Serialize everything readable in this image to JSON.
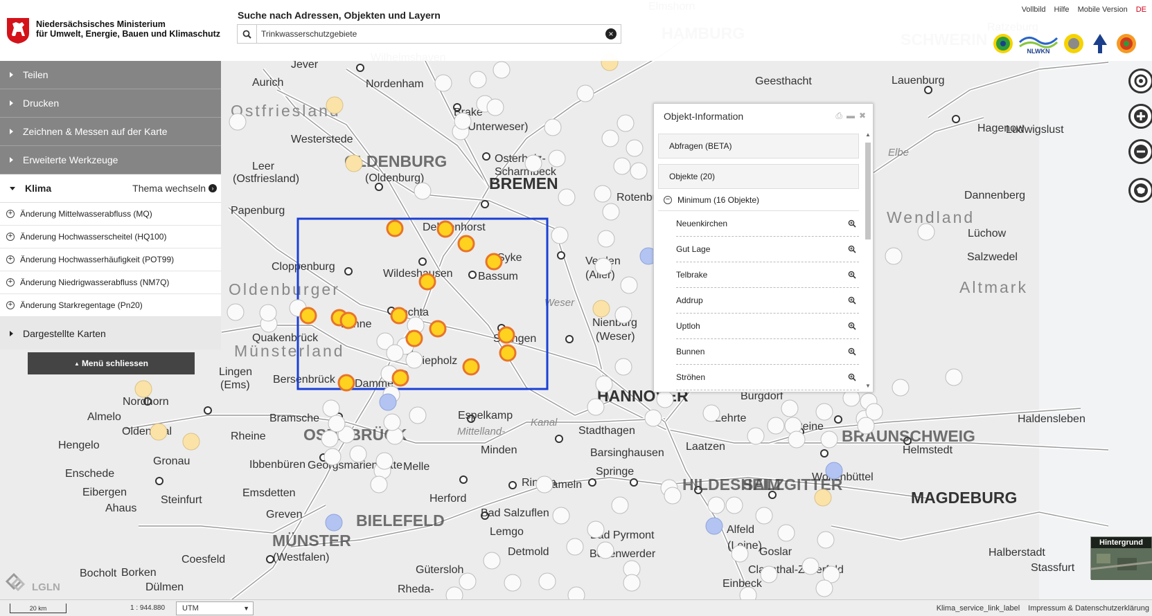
{
  "header": {
    "ministry_line1": "Niedersächsisches Ministerium",
    "ministry_line2": "für Umwelt, Energie, Bauen und Klimaschutz",
    "search_title": "Suche nach Adressen, Objekten und Layern",
    "search_value": "Trinkwasserschutzgebiete",
    "links": [
      "Vollbild",
      "Hilfe",
      "Mobile Version"
    ],
    "language": "DE",
    "partner_logo_text": "NLWKN"
  },
  "menu": {
    "items": [
      "Teilen",
      "Drucken",
      "Zeichnen & Messen auf der Karte",
      "Erweiterte Werkzeuge"
    ],
    "theme_title": "Klima",
    "theme_switch": "Thema wechseln",
    "layers": [
      "Änderung Mittelwasserabfluss (MQ)",
      "Änderung Hochwasserscheitel (HQ100)",
      "Änderung Hochwasserhäufigkeit (POT99)",
      "Änderung Niedrigwasserabfluss (NM7Q)",
      "Änderung Starkregentage (Pn20)"
    ],
    "maps_item": "Dargestellte Karten",
    "close_label": "Menü schliessen"
  },
  "info_panel": {
    "title": "Objekt-Information",
    "query_tab": "Abfragen (BETA)",
    "objects_header": "Objekte (20)",
    "group_label": "Minimum (16 Objekte)",
    "objects": [
      "Neuenkirchen",
      "Gut Lage",
      "Telbrake",
      "Addrup",
      "Uptloh",
      "Bunnen",
      "Ströhen"
    ]
  },
  "map": {
    "labels": [
      {
        "text": "HAMBURG",
        "cls": "big"
      },
      {
        "text": "SCHWERIN",
        "cls": "big"
      },
      {
        "text": "BREMEN",
        "cls": "city"
      },
      {
        "text": "HANNOVER",
        "cls": "city"
      },
      {
        "text": "BIELEFELD",
        "cls": "big"
      },
      {
        "text": "MAGDEBURG",
        "cls": "city"
      },
      {
        "text": "Ostfriesland",
        "cls": "region"
      },
      {
        "text": "Oldenburger",
        "cls": "region"
      },
      {
        "text": "Münsterland",
        "cls": "region"
      },
      {
        "text": "Wendland",
        "cls": "region"
      },
      {
        "text": "Altmark",
        "cls": "region"
      },
      {
        "text": "OLDENBURG",
        "cls": "big"
      },
      {
        "text": "(Oldenburg)",
        "cls": "town"
      },
      {
        "text": "OSNABRÜCK",
        "cls": "big"
      },
      {
        "text": "MÜNSTER",
        "cls": "big"
      },
      {
        "text": "(Westfalen)",
        "cls": "town"
      },
      {
        "text": "BRAUNSCHWEIG",
        "cls": "big"
      },
      {
        "text": "HILDESHEIM",
        "cls": "big"
      },
      {
        "text": "SALZGITTER",
        "cls": "big"
      },
      {
        "text": "Jever",
        "cls": "town"
      },
      {
        "text": "Wilhelmshaven",
        "cls": "town"
      },
      {
        "text": "Nordenham",
        "cls": "town"
      },
      {
        "text": "Aurich",
        "cls": "town"
      },
      {
        "text": "Westerstede",
        "cls": "town"
      },
      {
        "text": "Leer",
        "cls": "town"
      },
      {
        "text": "(Ostfriesland)",
        "cls": "town"
      },
      {
        "text": "Papenburg",
        "cls": "town"
      },
      {
        "text": "Cloppenburg",
        "cls": "town"
      },
      {
        "text": "Wildeshausen",
        "cls": "town"
      },
      {
        "text": "Delmenhorst",
        "cls": "town"
      },
      {
        "text": "Syke",
        "cls": "town"
      },
      {
        "text": "Bassum",
        "cls": "town"
      },
      {
        "text": "Vechta",
        "cls": "town"
      },
      {
        "text": "Lohne",
        "cls": "town"
      },
      {
        "text": "Diepholz",
        "cls": "town"
      },
      {
        "text": "Sulingen",
        "cls": "town"
      },
      {
        "text": "Quakenbrück",
        "cls": "town"
      },
      {
        "text": "Bersenbrück",
        "cls": "town"
      },
      {
        "text": "Damme",
        "cls": "town"
      },
      {
        "text": "Lingen",
        "cls": "town"
      },
      {
        "text": "(Ems)",
        "cls": "town"
      },
      {
        "text": "Nordhorn",
        "cls": "town"
      },
      {
        "text": "Almelo",
        "cls": "town"
      },
      {
        "text": "Oldenzaal",
        "cls": "town"
      },
      {
        "text": "Hengelo",
        "cls": "town"
      },
      {
        "text": "Gronau",
        "cls": "town"
      },
      {
        "text": "Enschede",
        "cls": "town"
      },
      {
        "text": "Eibergen",
        "cls": "town"
      },
      {
        "text": "Ahaus",
        "cls": "town"
      },
      {
        "text": "Steinfurt",
        "cls": "town"
      },
      {
        "text": "Rheine",
        "cls": "town"
      },
      {
        "text": "Ibbenbüren",
        "cls": "town"
      },
      {
        "text": "Emsdetten",
        "cls": "town"
      },
      {
        "text": "Greven",
        "cls": "town"
      },
      {
        "text": "Coesfeld",
        "cls": "town"
      },
      {
        "text": "Bocholt",
        "cls": "town"
      },
      {
        "text": "Borken",
        "cls": "town"
      },
      {
        "text": "Dülmen",
        "cls": "town"
      },
      {
        "text": "Bramsche",
        "cls": "town"
      },
      {
        "text": "Georgsmarienhütte",
        "cls": "town"
      },
      {
        "text": "Melle",
        "cls": "town"
      },
      {
        "text": "Espelkamp",
        "cls": "town"
      },
      {
        "text": "Minden",
        "cls": "town"
      },
      {
        "text": "Rinteln",
        "cls": "town"
      },
      {
        "text": "Herford",
        "cls": "town"
      },
      {
        "text": "Bad Salzuflen",
        "cls": "town"
      },
      {
        "text": "Lemgo",
        "cls": "town"
      },
      {
        "text": "Detmold",
        "cls": "town"
      },
      {
        "text": "Gütersloh",
        "cls": "town"
      },
      {
        "text": "Rheda-",
        "cls": "town"
      },
      {
        "text": "Hameln",
        "cls": "town"
      },
      {
        "text": "Bad Pyrmont",
        "cls": "town"
      },
      {
        "text": "Bodenwerder",
        "cls": "town"
      },
      {
        "text": "Stadthagen",
        "cls": "town"
      },
      {
        "text": "Barsinghausen",
        "cls": "town"
      },
      {
        "text": "Springe",
        "cls": "town"
      },
      {
        "text": "Laatzen",
        "cls": "town"
      },
      {
        "text": "Lehrte",
        "cls": "town"
      },
      {
        "text": "Burgdorf",
        "cls": "town"
      },
      {
        "text": "Peine",
        "cls": "town"
      },
      {
        "text": "Wolfenbüttel",
        "cls": "town"
      },
      {
        "text": "Helmstedt",
        "cls": "town"
      },
      {
        "text": "Haldensleben",
        "cls": "town"
      },
      {
        "text": "Halberstadt",
        "cls": "town"
      },
      {
        "text": "Stassfurt",
        "cls": "town"
      },
      {
        "text": "Alfeld",
        "cls": "town"
      },
      {
        "text": "(Leine)",
        "cls": "town"
      },
      {
        "text": "Goslar",
        "cls": "town"
      },
      {
        "text": "Clausthal-Zellerfeld",
        "cls": "town"
      },
      {
        "text": "Einbeck",
        "cls": "town"
      },
      {
        "text": "Nienburg",
        "cls": "town"
      },
      {
        "text": "(Weser)",
        "cls": "town"
      },
      {
        "text": "Verden",
        "cls": "town"
      },
      {
        "text": "(Aller)",
        "cls": "town"
      },
      {
        "text": "Rotenburg",
        "cls": "town"
      },
      {
        "text": "Osterholz-",
        "cls": "town"
      },
      {
        "text": "Scharmbeck",
        "cls": "town"
      },
      {
        "text": "Brake",
        "cls": "town"
      },
      {
        "text": "(Unterweser)",
        "cls": "town"
      },
      {
        "text": "Geesthacht",
        "cls": "town"
      },
      {
        "text": "Lauenburg",
        "cls": "town"
      },
      {
        "text": "Hagenow",
        "cls": "town"
      },
      {
        "text": "Ludwigslust",
        "cls": "town"
      },
      {
        "text": "Dannenberg",
        "cls": "town"
      },
      {
        "text": "Lüchow",
        "cls": "town"
      },
      {
        "text": "Salzwedel",
        "cls": "town"
      },
      {
        "text": "Ratzeburg",
        "cls": "town"
      },
      {
        "text": "Elmshorn",
        "cls": "town"
      },
      {
        "text": "Mittelland-",
        "cls": "river"
      },
      {
        "text": "Kanal",
        "cls": "river"
      },
      {
        "text": "Weser",
        "cls": "river"
      },
      {
        "text": "Elbe",
        "cls": "river"
      }
    ]
  },
  "bottom": {
    "scale_label": "20 km",
    "scale_value": "1 : 944.880",
    "crs": "UTM",
    "links": [
      "Klima_service_link_label",
      "Impressum & Datenschutzerklärung"
    ],
    "background_label": "Hintergrund",
    "lgln_label": "LGLN"
  },
  "colors": {
    "selection_box": "#1a3fd6",
    "marker_selected": "#ffd21f",
    "marker_border": "#e8742a",
    "menu_grey": "#858585"
  }
}
